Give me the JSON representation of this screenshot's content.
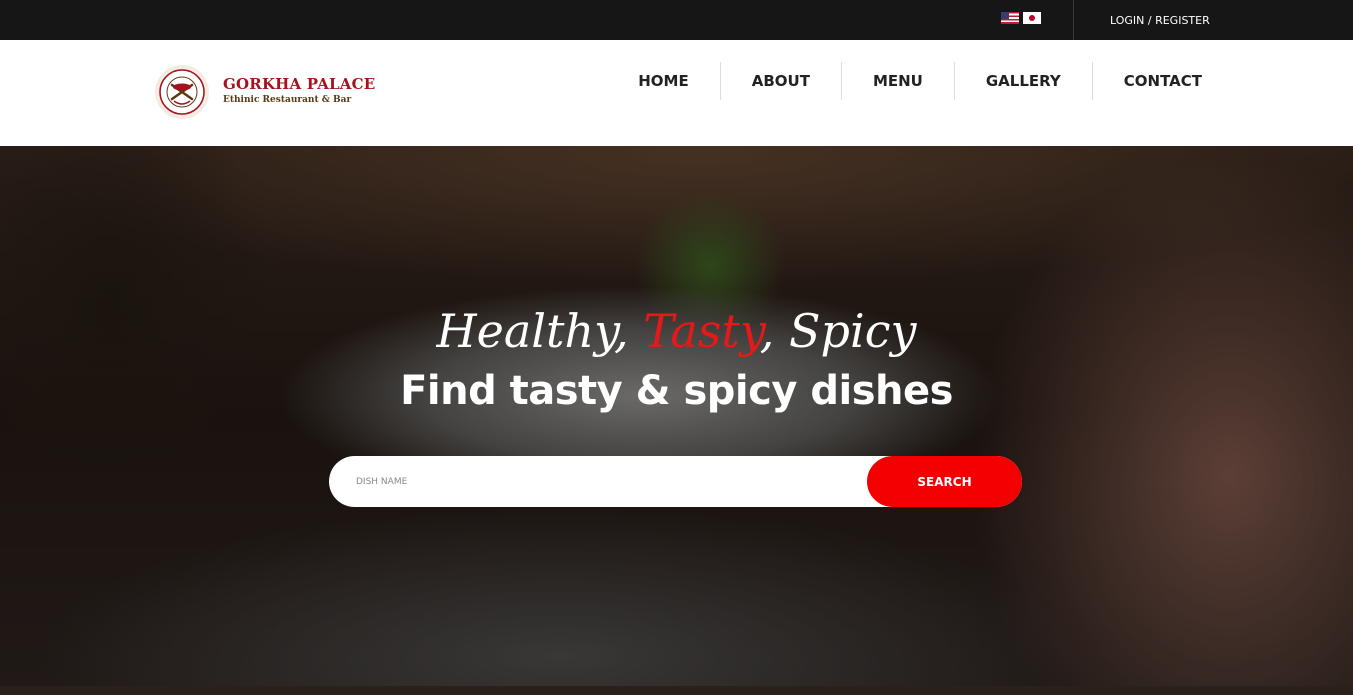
{
  "topbar": {
    "flags": [
      {
        "name": "us-flag-icon",
        "country": "United States"
      },
      {
        "name": "jp-flag-icon",
        "country": "Japan"
      }
    ],
    "login_label": "LOGIN / REGISTER"
  },
  "header": {
    "logo": {
      "title": "GORKHA PALACE",
      "subtitle": "Ethinic Restaurant & Bar"
    },
    "nav": [
      {
        "label": "HOME"
      },
      {
        "label": "ABOUT"
      },
      {
        "label": "MENU"
      },
      {
        "label": "GALLERY"
      },
      {
        "label": "CONTACT"
      }
    ]
  },
  "hero": {
    "tagline": {
      "part1": "Healthy, ",
      "accent": "Tasty",
      "part2": ", Spicy"
    },
    "heading": "Find tasty & spicy dishes",
    "search": {
      "placeholder": "DISH NAME",
      "value": "",
      "button_label": "SEARCH"
    }
  },
  "colors": {
    "accent_red": "#f40000",
    "topbar_bg": "#161616",
    "logo_title": "#a3141d"
  }
}
